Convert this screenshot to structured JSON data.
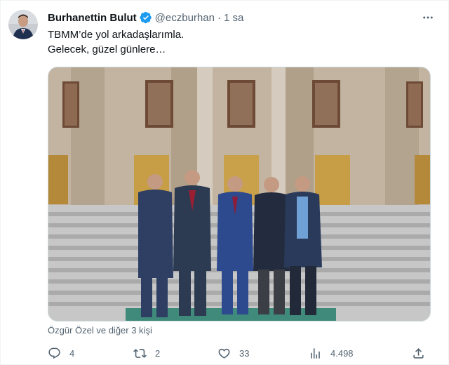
{
  "author": {
    "display_name": "Burhanettin Bulut",
    "handle": "@eczburhan",
    "separator": "·",
    "time": "1 sa"
  },
  "tweet": {
    "line1": "TBMM’de yol arkadaşlarımla.",
    "line2": "Gelecek, güzel günlere…"
  },
  "tagged_text": "Özgür Özel ve diğer 3 kişi",
  "actions": {
    "replies": "4",
    "retweets": "2",
    "likes": "33",
    "views": "4.498"
  },
  "icons": {
    "verified": "verified-badge-icon",
    "more": "more-icon",
    "reply": "reply-icon",
    "retweet": "retweet-icon",
    "like": "like-icon",
    "views": "views-icon",
    "share": "share-icon"
  },
  "colors": {
    "verified": "#1d9bf0",
    "secondary_text": "#536471",
    "primary_text": "#0f1419",
    "border": "#cfd9de"
  }
}
